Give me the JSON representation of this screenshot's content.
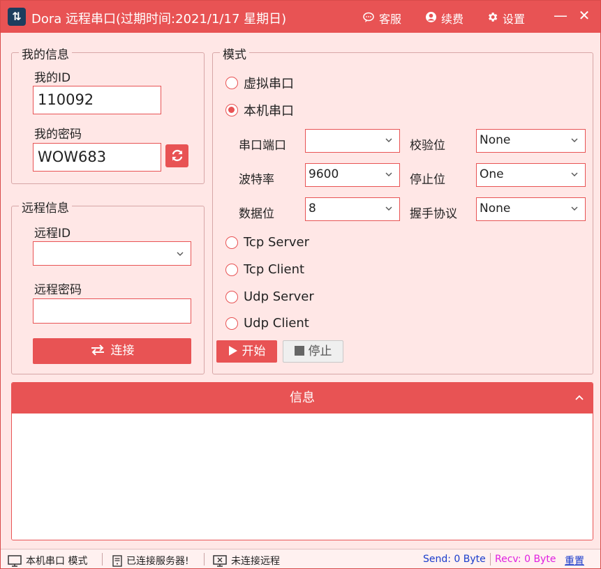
{
  "titlebar": {
    "title": "Dora 远程串口(过期时间:2021/1/17 星期日)",
    "service_label": "客服",
    "renew_label": "续费",
    "settings_label": "设置",
    "minimize": "—",
    "close": "✕"
  },
  "my_info": {
    "legend": "我的信息",
    "id_label": "我的ID",
    "id_value": "110092",
    "password_label": "我的密码",
    "password_value": "WOW683"
  },
  "remote_info": {
    "legend": "远程信息",
    "id_label": "远程ID",
    "id_value": "",
    "password_label": "远程密码",
    "password_value": "",
    "connect_label": "连接"
  },
  "mode": {
    "legend": "模式",
    "options": [
      {
        "label": "虚拟串口",
        "selected": false
      },
      {
        "label": "本机串口",
        "selected": true
      },
      {
        "label": "Tcp Server",
        "selected": false
      },
      {
        "label": "Tcp Client",
        "selected": false
      },
      {
        "label": "Udp Server",
        "selected": false
      },
      {
        "label": "Udp Client",
        "selected": false
      }
    ],
    "serial": {
      "port_label": "串口端口",
      "port_value": "",
      "baud_label": "波特率",
      "baud_value": "9600",
      "databits_label": "数据位",
      "databits_value": "8",
      "parity_label": "校验位",
      "parity_value": "None",
      "stopbits_label": "停止位",
      "stopbits_value": "One",
      "handshake_label": "握手协议",
      "handshake_value": "None"
    },
    "start_label": "开始",
    "stop_label": "停止"
  },
  "info_panel": {
    "title": "信息"
  },
  "statusbar": {
    "mode_text": "本机串口 模式",
    "server_text": "已连接服务器!",
    "remote_text": "未连接远程",
    "send_text": "Send: 0 Byte",
    "recv_text": "Recv: 0 Byte",
    "reset_text": "重置"
  },
  "colors": {
    "accent": "#e85354",
    "background": "#ffe7e6",
    "send": "#1a3ccc",
    "recv": "#e020e0"
  }
}
